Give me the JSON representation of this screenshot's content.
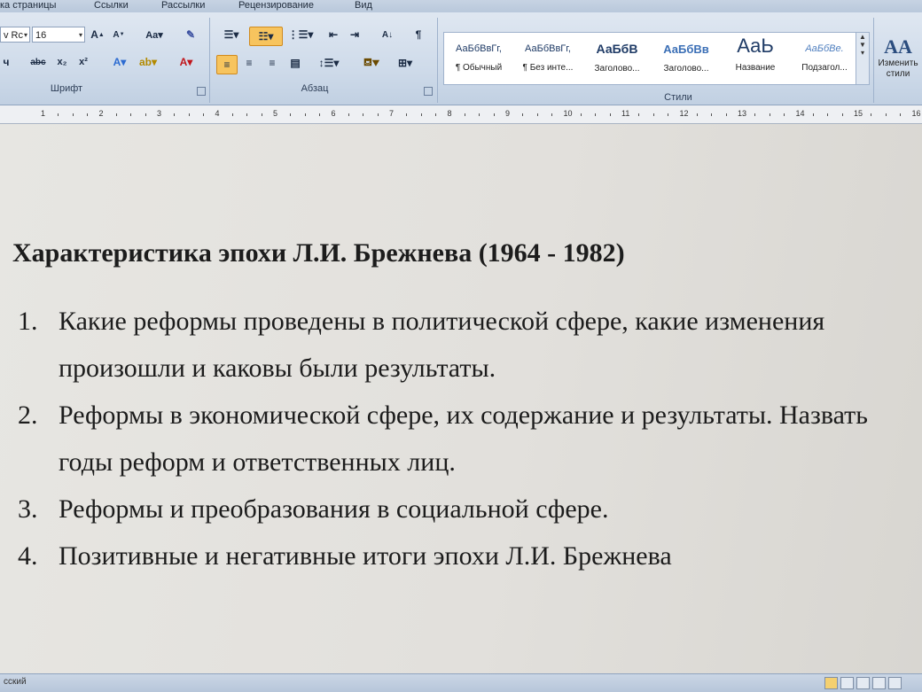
{
  "menu_tabs": [
    "ка страницы",
    "Ссылки",
    "Рассылки",
    "Рецензирование",
    "Вид"
  ],
  "ribbon": {
    "font_name_value": "v Rc",
    "font_size_value": "16",
    "groups": {
      "font": "Шрифт",
      "paragraph": "Абзац",
      "styles": "Стили"
    },
    "styles": [
      {
        "sample": "АаБбВвГг,",
        "name": "¶ Обычный"
      },
      {
        "sample": "АаБбВвГг,",
        "name": "¶ Без инте..."
      },
      {
        "sample": "АаБбВ",
        "name": "Заголово..."
      },
      {
        "sample": "АаБбВв",
        "name": "Заголово..."
      },
      {
        "sample": "АаЬ",
        "name": "Название"
      },
      {
        "sample": "АаБбВе.",
        "name": "Подзагол..."
      }
    ],
    "change_styles_label": "Изменить стили",
    "change_styles_icon": "AA"
  },
  "ruler_numbers": [
    "1",
    "2",
    "3",
    "4",
    "5",
    "6",
    "7",
    "8",
    "9",
    "10",
    "11",
    "12",
    "13",
    "14",
    "15",
    "16"
  ],
  "document": {
    "title": "Характеристика эпохи Л.И. Брежнева (1964 - 1982)",
    "items": [
      {
        "num": "1.",
        "text": "Какие реформы проведены в политической сфере, какие изменения произошли и каковы были результаты."
      },
      {
        "num": "2.",
        "text": "Реформы в экономической сфере, их содержание и результаты. Назвать годы реформ и ответственных лиц."
      },
      {
        "num": "3.",
        "text": "Реформы и преобразования в социальной сфере."
      },
      {
        "num": "4.",
        "text": "Позитивные и негативные итоги эпохи  Л.И. Брежнева"
      }
    ]
  },
  "statusbar": {
    "language": "сский"
  }
}
